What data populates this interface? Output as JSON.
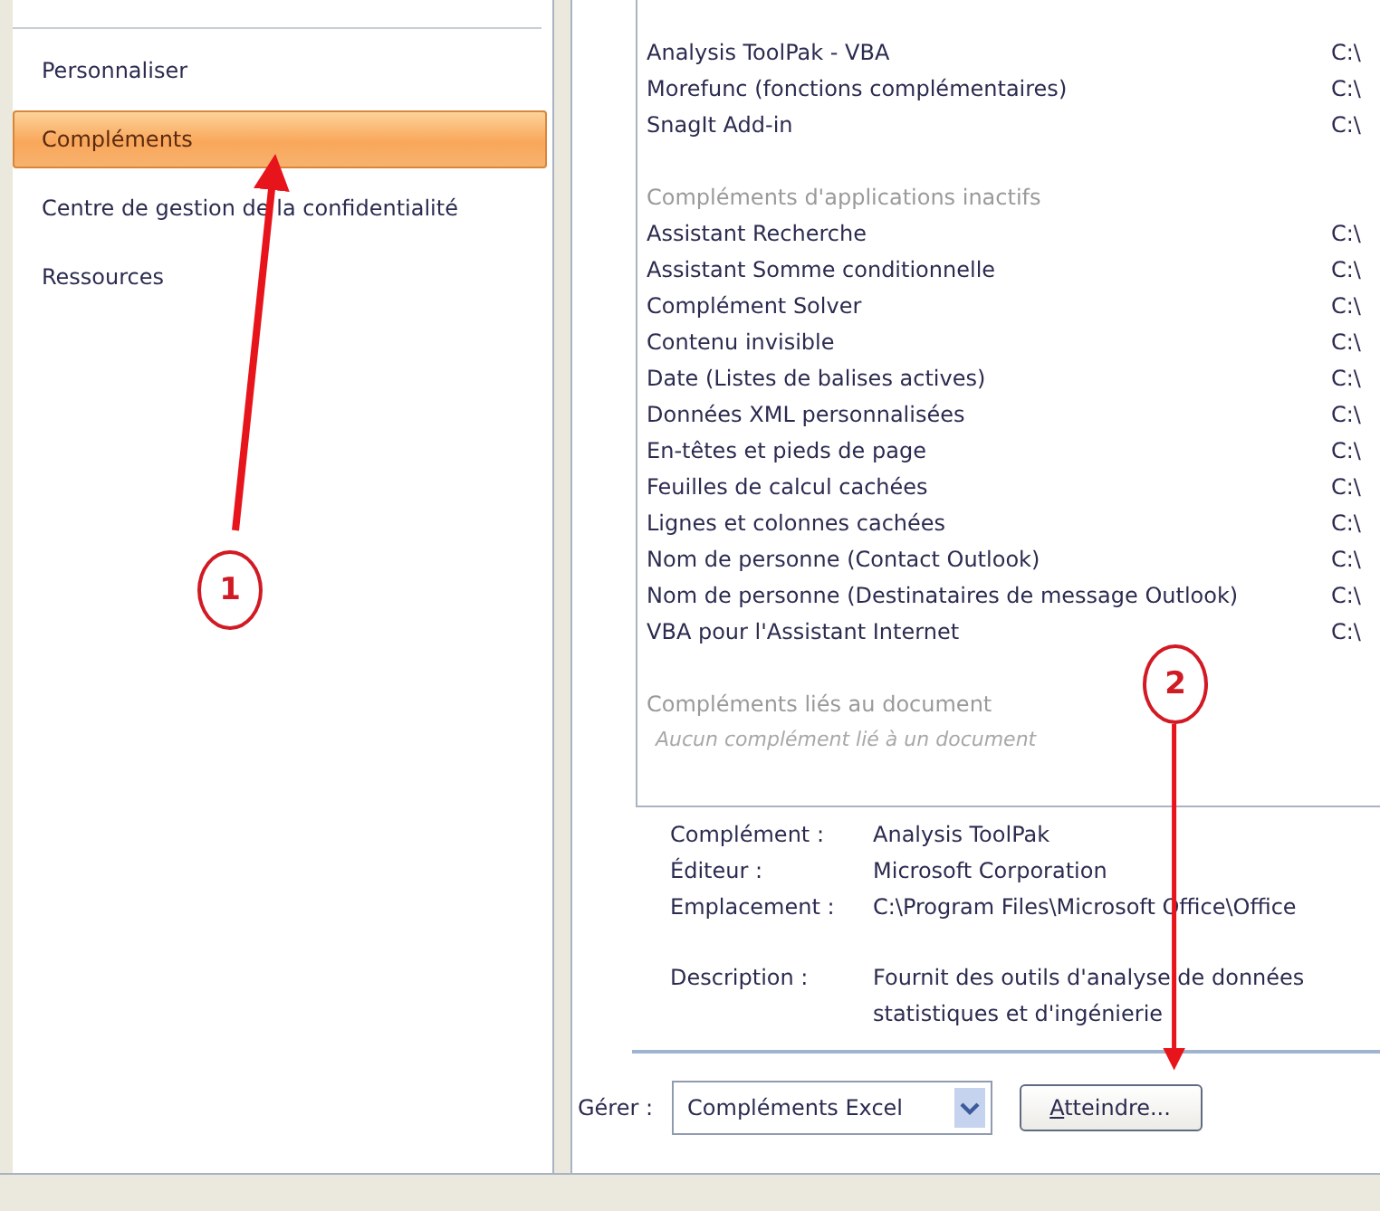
{
  "sidebar": {
    "items": [
      {
        "label": "Personnaliser",
        "selected": false
      },
      {
        "label": "Compléments",
        "selected": true
      },
      {
        "label": "Centre de gestion de la confidentialité",
        "selected": false
      },
      {
        "label": "Ressources",
        "selected": false
      }
    ]
  },
  "addins": {
    "sections": [
      {
        "kind": "items",
        "rows": [
          {
            "name": "Analysis ToolPak - VBA",
            "location": "C:\\"
          },
          {
            "name": "Morefunc (fonctions complémentaires)",
            "location": "C:\\"
          },
          {
            "name": "SnagIt Add-in",
            "location": "C:\\"
          }
        ]
      },
      {
        "kind": "heading",
        "title": "Compléments d'applications inactifs"
      },
      {
        "kind": "items",
        "rows": [
          {
            "name": "Assistant Recherche",
            "location": "C:\\"
          },
          {
            "name": "Assistant Somme conditionnelle",
            "location": "C:\\"
          },
          {
            "name": "Complément Solver",
            "location": "C:\\"
          },
          {
            "name": "Contenu invisible",
            "location": "C:\\"
          },
          {
            "name": "Date (Listes de balises actives)",
            "location": "C:\\"
          },
          {
            "name": "Données XML personnalisées",
            "location": "C:\\"
          },
          {
            "name": "En-têtes et pieds de page",
            "location": "C:\\"
          },
          {
            "name": "Feuilles de calcul cachées",
            "location": "C:\\"
          },
          {
            "name": "Lignes et colonnes cachées",
            "location": "C:\\"
          },
          {
            "name": "Nom de personne (Contact Outlook)",
            "location": "C:\\"
          },
          {
            "name": "Nom de personne (Destinataires de message Outlook)",
            "location": "C:\\"
          },
          {
            "name": "VBA pour l'Assistant Internet",
            "location": "C:\\"
          }
        ]
      },
      {
        "kind": "heading",
        "title": "Compléments liés au document"
      },
      {
        "kind": "note",
        "text": "Aucun complément lié à un document"
      }
    ]
  },
  "details": [
    {
      "label": "Complément :",
      "lines": [
        "Analysis ToolPak"
      ]
    },
    {
      "label": "Éditeur :",
      "lines": [
        "Microsoft Corporation"
      ]
    },
    {
      "label": "Emplacement :",
      "lines": [
        "C:\\Program Files\\Microsoft Office\\Office"
      ]
    },
    {
      "label": "Description :",
      "lines": [
        "Fournit des outils d'analyse de données",
        "statistiques et d'ingénierie"
      ]
    }
  ],
  "manage": {
    "label": "Gérer :",
    "value": "Compléments Excel",
    "button": "Atteindre..."
  },
  "annotations": [
    {
      "number": "1"
    },
    {
      "number": "2"
    }
  ]
}
